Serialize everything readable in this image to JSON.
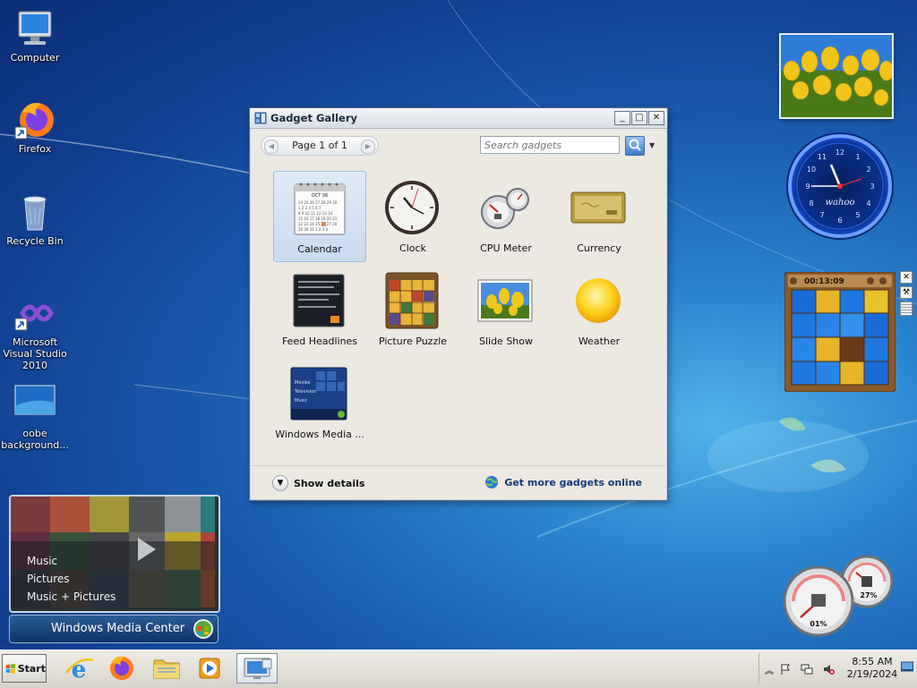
{
  "desktop": {
    "icons": [
      {
        "label": "Computer"
      },
      {
        "label": "Firefox"
      },
      {
        "label": "Recycle Bin"
      },
      {
        "label": "Microsoft Visual Studio 2010"
      },
      {
        "label": "oobe background..."
      }
    ]
  },
  "gallery": {
    "title": "Gadget Gallery",
    "page_label": "Page 1 of 1",
    "search_placeholder": "Search gadgets",
    "gadgets": [
      {
        "label": "Calendar",
        "selected": true
      },
      {
        "label": "Clock"
      },
      {
        "label": "CPU Meter"
      },
      {
        "label": "Currency"
      },
      {
        "label": "Feed Headlines"
      },
      {
        "label": "Picture Puzzle"
      },
      {
        "label": "Slide Show"
      },
      {
        "label": "Weather"
      },
      {
        "label": "Windows Media ..."
      }
    ],
    "calendar_month": "OCT 06",
    "show_details": "Show details",
    "get_more": "Get more gadgets online"
  },
  "clock_gadget": {
    "brand": "wahoo"
  },
  "puzzle_gadget": {
    "timer": "00:13:09"
  },
  "cpu_gadget": {
    "cpu_percent": "01%",
    "memory_percent": "27%"
  },
  "media_center": {
    "items": [
      "Music",
      "Pictures",
      "Music + Pictures"
    ],
    "brand": "Windows Media Center"
  },
  "taskbar": {
    "start_label": "Start",
    "time": "8:55 AM",
    "date": "2/19/2024"
  },
  "colors": {
    "accent": "#1a5db0",
    "link": "#163a7a"
  }
}
